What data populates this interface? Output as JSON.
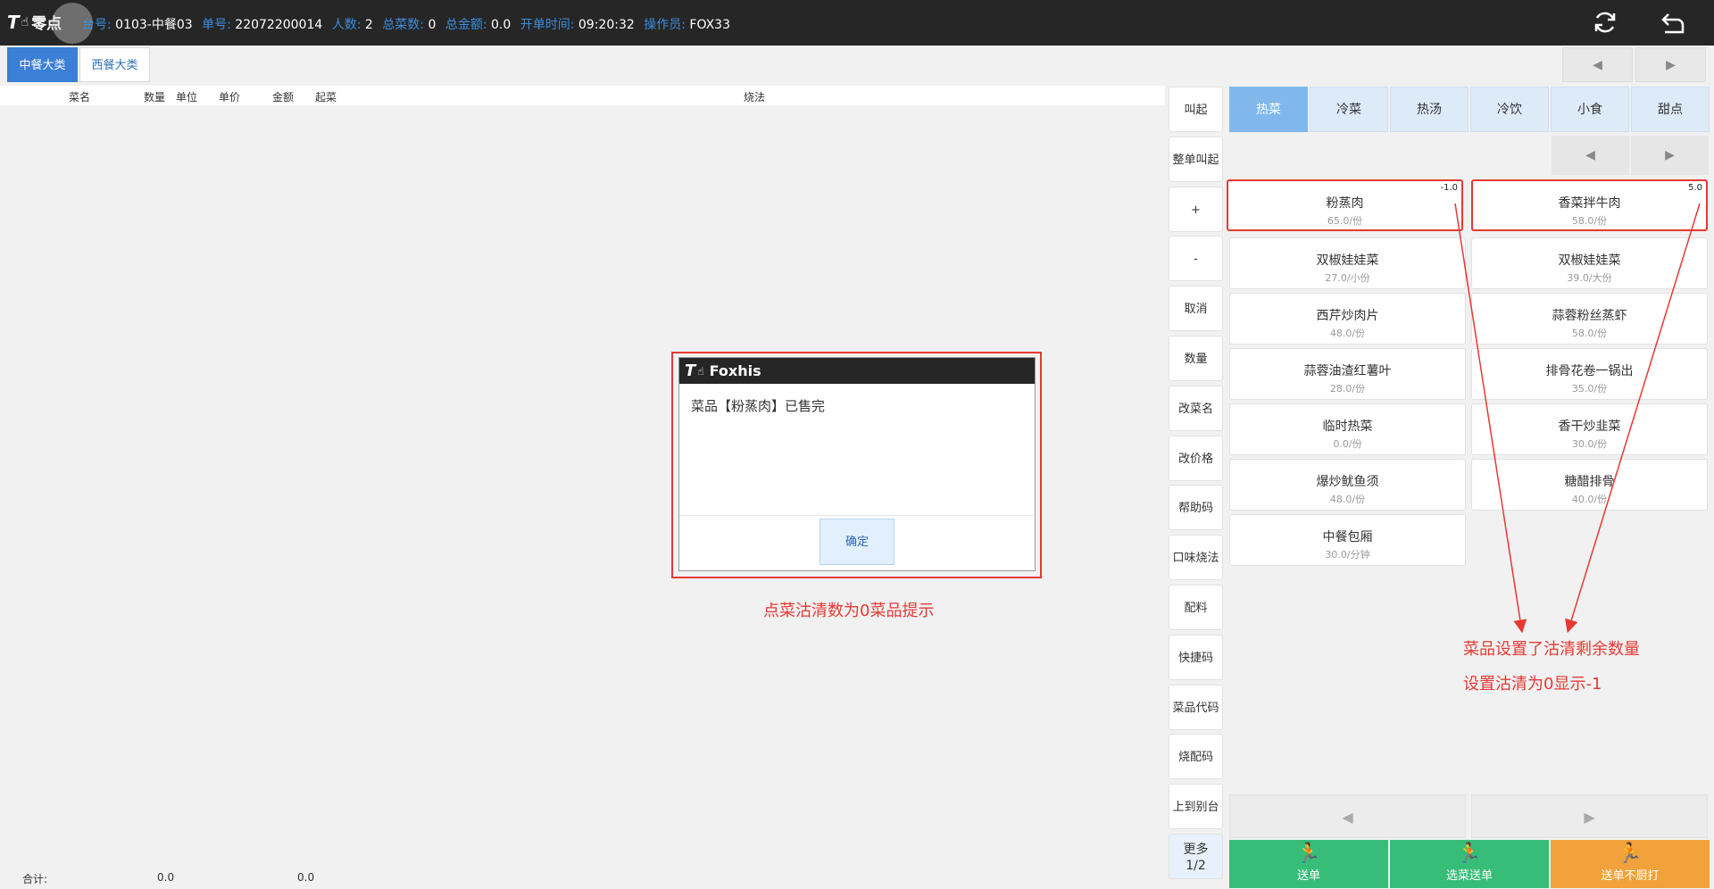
{
  "topbar": {
    "logo_text": "零点",
    "table_label": "台号:",
    "table_value": "0103-中餐03",
    "order_label": "单号:",
    "order_value": "22072200014",
    "people_label": "人数:",
    "people_value": "2",
    "dish_count_label": "总菜数:",
    "dish_count_value": "0",
    "total_label": "总金额:",
    "total_value": "0.0",
    "open_time_label": "开单时间:",
    "open_time_value": "09:20:32",
    "operator_label": "操作员:",
    "operator_value": "FOX33",
    "refresh_icon": "refresh-icon",
    "back_icon": "return-icon"
  },
  "category_tabs": [
    {
      "label": "中餐大类",
      "active": true
    },
    {
      "label": "西餐大类",
      "active": false
    }
  ],
  "order_table": {
    "columns": [
      "菜名",
      "数量",
      "单位",
      "单价",
      "金额",
      "起菜",
      "烧法"
    ],
    "footer": {
      "label": "合计:",
      "qty_total": "0.0",
      "amount_total": "0.0"
    }
  },
  "pager": {
    "prev": "◀",
    "next": "▶"
  },
  "function_buttons": [
    "叫起",
    "整单叫起",
    "+",
    "-",
    "取消",
    "数量",
    "改菜名",
    "改价格",
    "帮助码",
    "口味烧法",
    "配料",
    "快捷码",
    "菜品代码",
    "烧配码",
    "上到别台"
  ],
  "more_button": {
    "line1": "更多",
    "line2": "1/2"
  },
  "sub_categories": [
    {
      "label": "热菜",
      "active": true
    },
    {
      "label": "冷菜",
      "active": false
    },
    {
      "label": "热汤",
      "active": false
    },
    {
      "label": "冷饮",
      "active": false
    },
    {
      "label": "小食",
      "active": false
    },
    {
      "label": "甜点",
      "active": false
    }
  ],
  "dishes": [
    {
      "name": "粉蒸肉",
      "price": "65.0/份",
      "badge": "-1.0",
      "highlight": true
    },
    {
      "name": "香菜拌牛肉",
      "price": "58.0/份",
      "badge": "5.0",
      "highlight": true
    },
    {
      "name": "双椒娃娃菜",
      "price": "27.0/小份",
      "badge": ""
    },
    {
      "name": "双椒娃娃菜",
      "price": "39.0/大份",
      "badge": ""
    },
    {
      "name": "西芹炒肉片",
      "price": "48.0/份",
      "badge": ""
    },
    {
      "name": "蒜蓉粉丝蒸虾",
      "price": "58.0/份",
      "badge": ""
    },
    {
      "name": "蒜蓉油渣红薯叶",
      "price": "28.0/份",
      "badge": ""
    },
    {
      "name": "排骨花卷一锅出",
      "price": "35.0/份",
      "badge": ""
    },
    {
      "name": "临时热菜",
      "price": "0.0/份",
      "badge": ""
    },
    {
      "name": "香干炒韭菜",
      "price": "30.0/份",
      "badge": ""
    },
    {
      "name": "爆炒鱿鱼须",
      "price": "48.0/份",
      "badge": ""
    },
    {
      "name": "糖醋排骨",
      "price": "40.0/份",
      "badge": ""
    },
    {
      "name": "中餐包厢",
      "price": "30.0/分钟",
      "badge": ""
    }
  ],
  "bottom_pager": {
    "prev": "◀",
    "next": "▶"
  },
  "actions": [
    {
      "label": "送单",
      "icon": "runner-icon"
    },
    {
      "label": "选菜送单",
      "icon": "runner-icon"
    },
    {
      "label": "送单不厨打",
      "icon": "runner-icon"
    }
  ],
  "dialog": {
    "title": "Foxhis",
    "message": "菜品【粉蒸肉】已售完",
    "ok_label": "确定"
  },
  "annotations": {
    "dialog_note": "点菜沽清数为0菜品提示",
    "dish_note_1": "菜品设置了沽清剩余数量",
    "dish_note_2": "设置沽清为0显示-1"
  },
  "colors": {
    "topbar": "#262626",
    "accent_blue": "#3b7fd6",
    "action_green": "#37bd78",
    "action_orange": "#f2a23a",
    "annotation_red": "#e53935"
  }
}
